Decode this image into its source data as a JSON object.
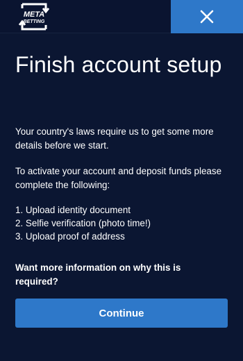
{
  "header": {
    "logo_icon": "meta-betting-logo",
    "logo_line1": "META",
    "logo_line2": "BETTING",
    "close_icon": "close-icon",
    "accent_color": "#2e78c9"
  },
  "main": {
    "title": "Finish account setup",
    "paragraph1": "Your country's laws require us to get some more details before we start.",
    "paragraph2": "To activate your account and deposit funds please complete the following:",
    "steps": [
      "1. Upload identity document",
      "2. Selfie verification (photo time!)",
      "3. Upload proof of address"
    ],
    "more_info_link": "Want more information on why this is required?",
    "continue_label": "Continue"
  },
  "colors": {
    "background": "#0b1632",
    "button": "#2e78c9",
    "text": "#ffffff"
  }
}
